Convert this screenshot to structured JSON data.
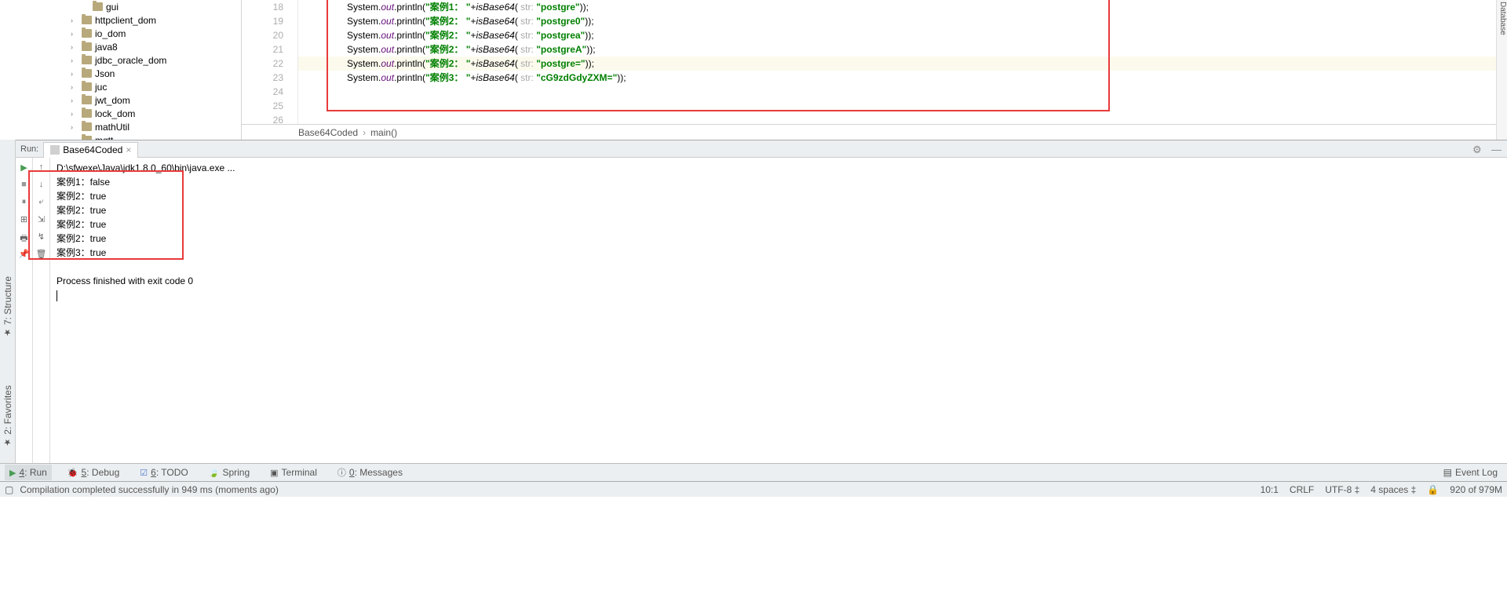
{
  "sidebar": {
    "items": [
      {
        "label": "gui"
      },
      {
        "label": "httpclient_dom"
      },
      {
        "label": "io_dom"
      },
      {
        "label": "java8"
      },
      {
        "label": "jdbc_oracle_dom"
      },
      {
        "label": "Json"
      },
      {
        "label": "juc"
      },
      {
        "label": "jwt_dom"
      },
      {
        "label": "lock_dom"
      },
      {
        "label": "mathUtil"
      },
      {
        "label": "mqtt"
      }
    ]
  },
  "editor": {
    "lines": [
      {
        "num": 18,
        "class": "System",
        "field": "out",
        "method": "println",
        "prefix": "案例1：",
        "call": "isBase64",
        "hint": "str:",
        "arg": "postgre"
      },
      {
        "num": 19,
        "class": "System",
        "field": "out",
        "method": "println",
        "prefix": "案例2：",
        "call": "isBase64",
        "hint": "str:",
        "arg": "postgre0"
      },
      {
        "num": 20,
        "class": "System",
        "field": "out",
        "method": "println",
        "prefix": "案例2：",
        "call": "isBase64",
        "hint": "str:",
        "arg": "postgrea"
      },
      {
        "num": 21,
        "class": "System",
        "field": "out",
        "method": "println",
        "prefix": "案例2：",
        "call": "isBase64",
        "hint": "str:",
        "arg": "postgreA"
      },
      {
        "num": 22,
        "class": "System",
        "field": "out",
        "method": "println",
        "prefix": "案例2：",
        "call": "isBase64",
        "hint": "str:",
        "arg": "postgre=",
        "hl": true
      },
      {
        "num": 23,
        "class": "System",
        "field": "out",
        "method": "println",
        "prefix": "案例3：",
        "call": "isBase64",
        "hint": "str:",
        "arg": "cG9zdGdyZXM="
      },
      {
        "num": 24,
        "blank": true
      },
      {
        "num": 25,
        "blank": true
      },
      {
        "num": 26,
        "blank": true,
        "partial": true
      }
    ]
  },
  "breadcrumb": {
    "a": "Base64Coded",
    "b": "main()"
  },
  "run": {
    "label": "Run:",
    "tab": "Base64Coded",
    "path": "D:\\sfwexe\\Java\\jdk1.8.0_60\\bin\\java.exe ...",
    "output": [
      "案例1：false",
      "案例2：true",
      "案例2：true",
      "案例2：true",
      "案例2：true",
      "案例3：true"
    ],
    "exit": "Process finished with exit code 0"
  },
  "bottom_tabs": {
    "run": "4: Run",
    "debug": "5: Debug",
    "todo": "6: TODO",
    "spring": "Spring",
    "terminal": "Terminal",
    "messages": "0: Messages",
    "event_log": "Event Log"
  },
  "status": {
    "message": "Compilation completed successfully in 949 ms (moments ago)",
    "pos": "10:1",
    "eol": "CRLF",
    "enc": "UTF-8",
    "indent": "4 spaces",
    "mem": "920 of 979M"
  },
  "left_tabs": {
    "structure": "7: Structure",
    "favorites": "2: Favorites"
  },
  "right_tab": "Database"
}
